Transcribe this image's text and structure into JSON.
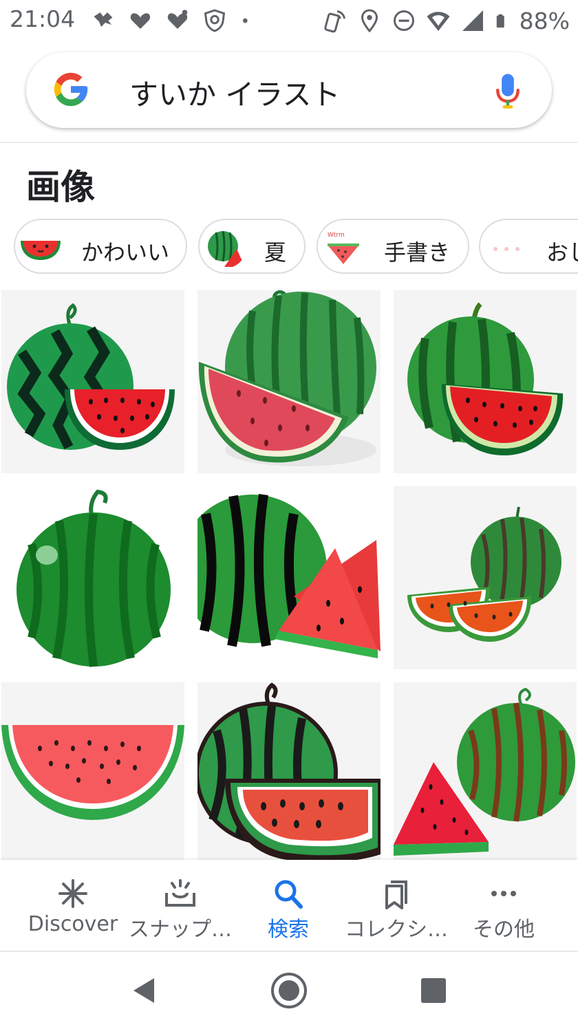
{
  "status_bar": {
    "time": "21:04",
    "battery_percent": "88%",
    "left_icons": [
      "notification-icon",
      "heart-icon",
      "heart-icon",
      "shield-icon",
      "dot-icon"
    ],
    "right_icons": [
      "nfc-icon",
      "location-icon",
      "dnd-icon",
      "wifi-icon",
      "signal-icon",
      "battery-icon"
    ]
  },
  "search": {
    "query": "すいか イラスト"
  },
  "section": {
    "title": "画像"
  },
  "chips": [
    {
      "label": "かわいい"
    },
    {
      "label": "夏"
    },
    {
      "label": "手書き"
    },
    {
      "label": "おし"
    }
  ],
  "images": [
    {
      "alt": "watermelon-1"
    },
    {
      "alt": "watermelon-2"
    },
    {
      "alt": "watermelon-3"
    },
    {
      "alt": "watermelon-4"
    },
    {
      "alt": "watermelon-5"
    },
    {
      "alt": "watermelon-6"
    },
    {
      "alt": "watermelon-7"
    },
    {
      "alt": "watermelon-8"
    },
    {
      "alt": "watermelon-9"
    }
  ],
  "bottom_nav": [
    {
      "label": "Discover",
      "icon": "asterisk-icon",
      "active": false
    },
    {
      "label": "スナップ…",
      "icon": "snapshot-icon",
      "active": false
    },
    {
      "label": "検索",
      "icon": "search-icon",
      "active": true
    },
    {
      "label": "コレクシ…",
      "icon": "collections-icon",
      "active": false
    },
    {
      "label": "その他",
      "icon": "more-icon",
      "active": false
    }
  ],
  "colors": {
    "accent": "#1a73e8",
    "google_blue": "#4285F4",
    "google_red": "#EA4335",
    "google_yellow": "#FBBC05",
    "google_green": "#34A853"
  }
}
